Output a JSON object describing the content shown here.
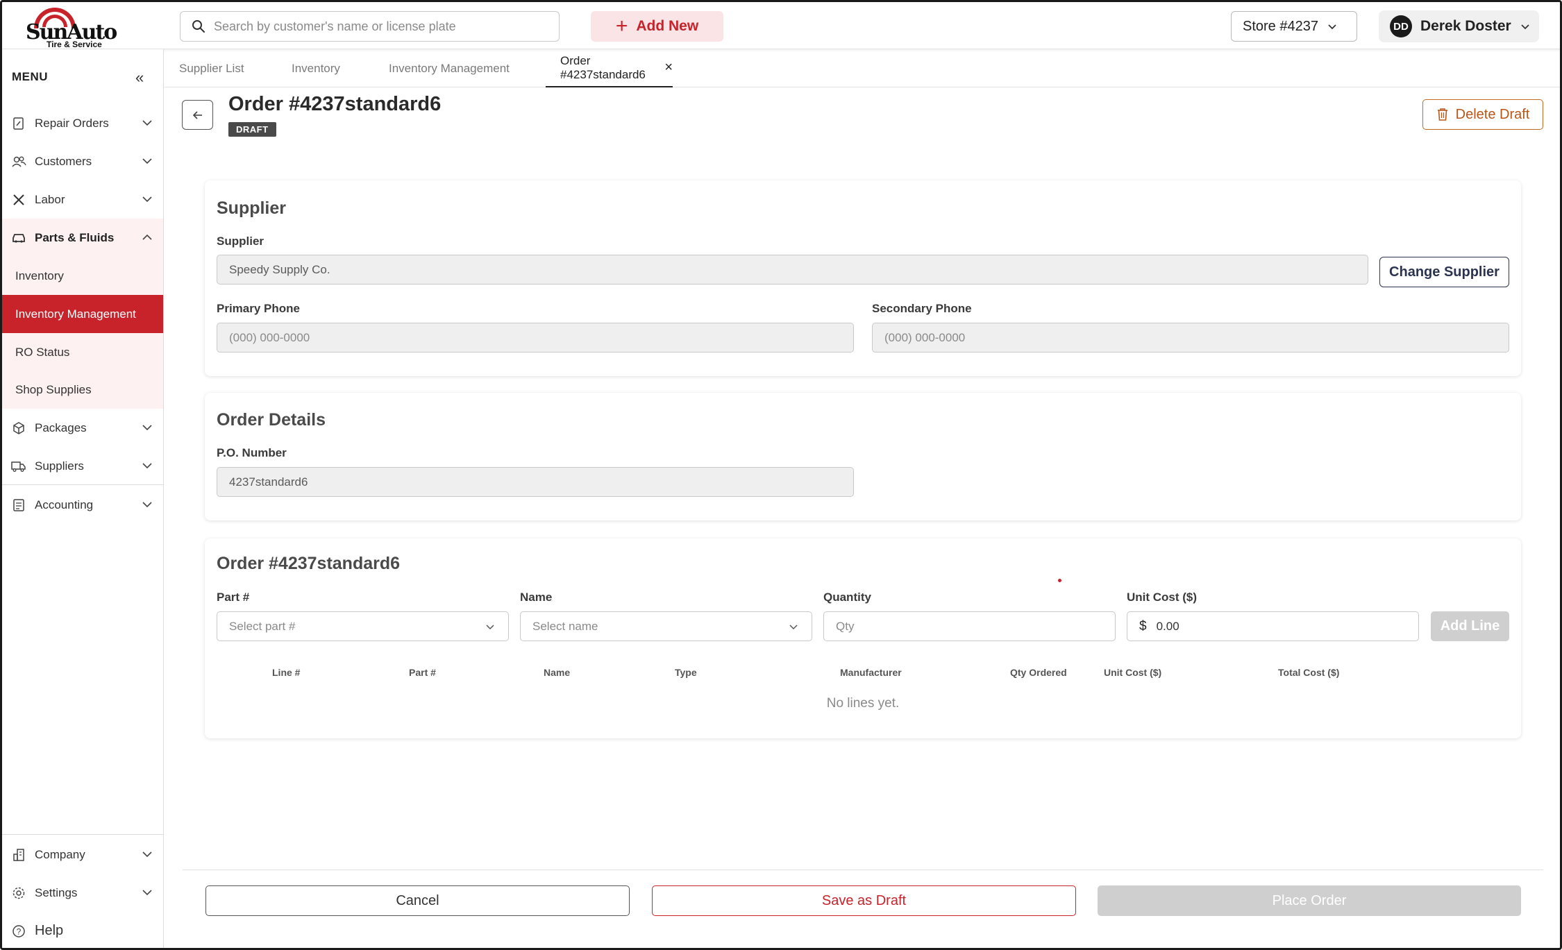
{
  "brand": {
    "name": "SunAuto",
    "tagline": "Tire & Service",
    "accent": "#c8232b"
  },
  "header": {
    "search_placeholder": "Search by customer's name or license plate",
    "add_new_label": "Add New",
    "store_label": "Store #4237",
    "user_initials": "DD",
    "user_name": "Derek Doster"
  },
  "sidebar": {
    "menu_label": "MENU",
    "items": [
      {
        "label": "Repair Orders",
        "icon": "repair-order-icon"
      },
      {
        "label": "Customers",
        "icon": "customers-icon"
      },
      {
        "label": "Labor",
        "icon": "tools-icon"
      },
      {
        "label": "Parts & Fluids",
        "icon": "car-icon",
        "expanded": true
      },
      {
        "label": "Packages",
        "icon": "package-icon"
      },
      {
        "label": "Suppliers",
        "icon": "truck-icon"
      },
      {
        "label": "Accounting",
        "icon": "ledger-icon"
      }
    ],
    "sub_items": [
      "Inventory",
      "Inventory Management",
      "RO Status",
      "Shop Supplies"
    ],
    "active_sub_item": "Inventory Management",
    "bottom_items": [
      {
        "label": "Company",
        "icon": "building-icon"
      },
      {
        "label": "Settings",
        "icon": "gear-icon"
      },
      {
        "label": "Help",
        "icon": "help-icon"
      }
    ]
  },
  "tabs": [
    {
      "label": "Supplier List"
    },
    {
      "label": "Inventory"
    },
    {
      "label": "Inventory Management"
    },
    {
      "label": "Order #4237standard6",
      "active": true
    }
  ],
  "page": {
    "title": "Order #4237standard6",
    "status_badge": "DRAFT",
    "delete_label": "Delete Draft"
  },
  "supplier": {
    "section_title": "Supplier",
    "supplier_label": "Supplier",
    "supplier_value": "Speedy Supply Co.",
    "change_label": "Change Supplier",
    "primary_phone_label": "Primary Phone",
    "primary_phone_placeholder": "(000) 000-0000",
    "secondary_phone_label": "Secondary Phone",
    "secondary_phone_placeholder": "(000) 000-0000"
  },
  "order_details": {
    "section_title": "Order Details",
    "po_label": "P.O. Number",
    "po_value": "4237standard6"
  },
  "order_lines": {
    "section_title": "Order #4237standard6",
    "part_label": "Part #",
    "part_placeholder": "Select part #",
    "name_label": "Name",
    "name_placeholder": "Select name",
    "qty_label": "Quantity",
    "qty_placeholder": "Qty",
    "unit_cost_label": "Unit Cost ($)",
    "currency_symbol": "$",
    "unit_cost_value": "0.00",
    "add_line_label": "Add Line",
    "columns": [
      "Line #",
      "Part #",
      "Name",
      "Type",
      "Manufacturer",
      "Qty Ordered",
      "Unit Cost ($)",
      "Total Cost ($)"
    ],
    "empty_message": "No lines yet."
  },
  "footer": {
    "cancel_label": "Cancel",
    "save_draft_label": "Save as Draft",
    "place_order_label": "Place Order"
  }
}
